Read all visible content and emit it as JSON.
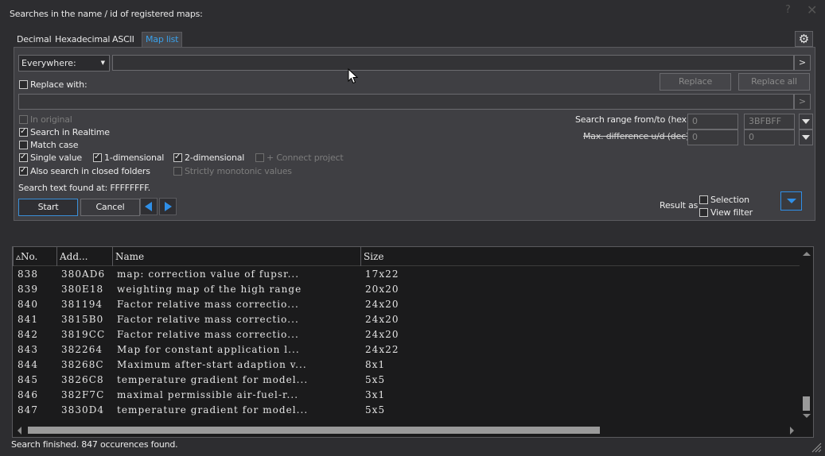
{
  "window": {
    "title": "Searches in the name / id of registered maps:",
    "help_label": "?",
    "close_label": "✕"
  },
  "tabs": [
    {
      "label": "Decimal",
      "active": false
    },
    {
      "label": "Hexadecimal",
      "active": false
    },
    {
      "label": "ASCII",
      "active": false
    },
    {
      "label": "Map list",
      "active": true
    }
  ],
  "search": {
    "scope_value": "Everywhere:",
    "query_value": "",
    "go_label": ">",
    "replace_with_label": "Replace with:",
    "replace_value": "",
    "replace_go_label": ">",
    "replace_label": "Replace",
    "replace_all_label": "Replace all"
  },
  "options": {
    "in_original": {
      "label": "In original",
      "checked": false,
      "disabled": true
    },
    "search_realtime": {
      "label": "Search in Realtime",
      "checked": true
    },
    "match_case": {
      "label": "Match case",
      "checked": false
    },
    "single_value": {
      "label": "Single value",
      "checked": true
    },
    "one_dim": {
      "label": "1-dimensional",
      "checked": true
    },
    "two_dim": {
      "label": "2-dimensional",
      "checked": true
    },
    "connect_project": {
      "label": "+ Connect project",
      "checked": false,
      "disabled": true
    },
    "closed_folders": {
      "label": "Also search in closed folders",
      "checked": true
    },
    "strictly_monotonic": {
      "label": "Strictly monotonic values",
      "checked": false,
      "disabled": true
    }
  },
  "range": {
    "from_to_label": "Search range from/to (hex)",
    "from_value": "0",
    "to_value": "3BFBFF",
    "max_diff_label": "Max. difference u/d (dec)",
    "diff_up": "0",
    "diff_down": "0"
  },
  "found_text": "Search text found at: FFFFFFFF.",
  "buttons": {
    "start": "Start",
    "cancel": "Cancel"
  },
  "result_as": {
    "label": "Result as",
    "selection": "Selection",
    "view_filter": "View filter"
  },
  "grid": {
    "columns": [
      "No.",
      "Add...",
      "Name",
      "Size"
    ],
    "sort_indicator": "▵",
    "rows": [
      [
        "838",
        "380AD6",
        "map: correction value of fupsr...",
        "17x22"
      ],
      [
        "839",
        "380E18",
        "weighting map of the high range",
        "20x20"
      ],
      [
        "840",
        "381194",
        "Factor relative mass correctio...",
        "24x20"
      ],
      [
        "841",
        "3815B0",
        "Factor relative mass correctio...",
        "24x20"
      ],
      [
        "842",
        "3819CC",
        "Factor relative mass correctio...",
        "24x20"
      ],
      [
        "843",
        "382264",
        "Map for constant application l...",
        "24x22"
      ],
      [
        "844",
        "38268C",
        "Maximum after-start adaption v...",
        "8x1"
      ],
      [
        "845",
        "3826C8",
        "temperature gradient for model...",
        "5x5"
      ],
      [
        "846",
        "382F7C",
        "maximal permissible air-fuel-r...",
        "3x1"
      ],
      [
        "847",
        "3830D4",
        "temperature gradient for model...",
        "5x5"
      ]
    ]
  },
  "status": "Search finished. 847 occurences found."
}
